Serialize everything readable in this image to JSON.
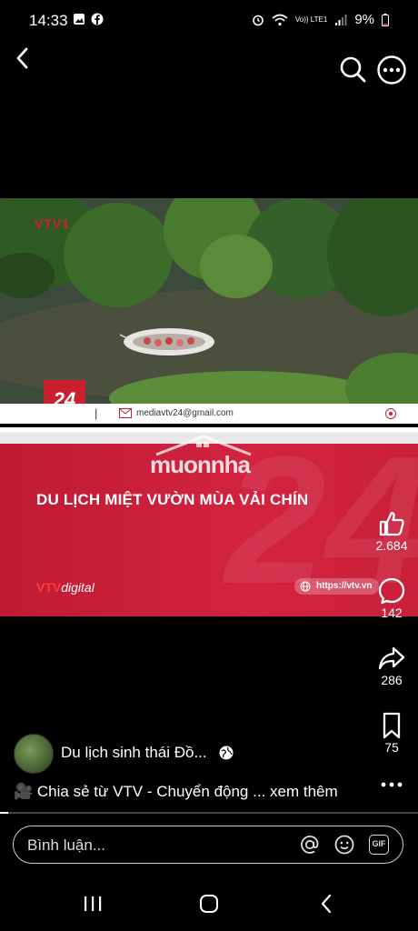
{
  "status": {
    "time": "14:33",
    "network": "Vo)) LTE1",
    "battery": "9%"
  },
  "video": {
    "channel_logo": "VTV1",
    "news_badge": "24",
    "email": "mediavtv24@gmail.com",
    "watermark": "muonnha",
    "headline": "DU LỊCH MIỆT VƯỜN MÙA VẢI CHÍN",
    "brand_main": "VTV",
    "brand_sub": "digital",
    "url": "https://vtv.vn"
  },
  "actions": {
    "likes": "2.684",
    "comments": "142",
    "shares": "286",
    "saves": "75"
  },
  "post": {
    "channel_name": "Du lịch sinh thái Đồ...",
    "caption": "🎥 Chia sẻ từ VTV - Chuyển động ... xem thêm",
    "progress": 0.02
  },
  "comment": {
    "placeholder": "Bình luận..."
  },
  "icons": [
    "back-icon",
    "search-icon",
    "more-icon",
    "like-icon",
    "comment-icon",
    "share-icon",
    "bookmark-icon",
    "globe-icon",
    "at-icon",
    "emoji-icon",
    "gif-icon"
  ]
}
